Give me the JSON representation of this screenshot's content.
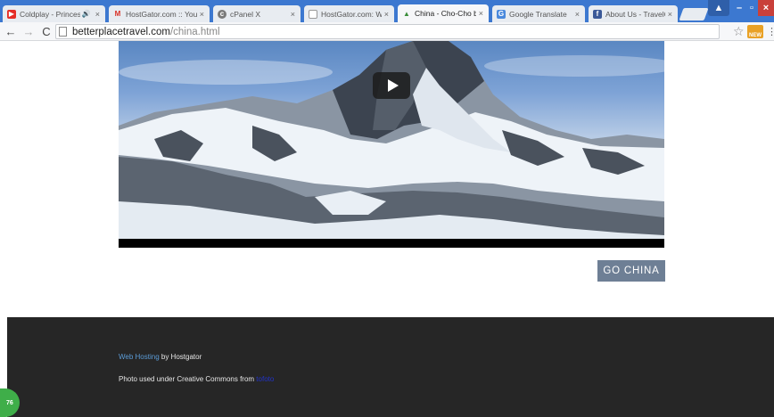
{
  "browser": {
    "tabs": [
      {
        "title": "Coldplay - Princes",
        "favicon": "youtube-icon",
        "audio": true,
        "active": false
      },
      {
        "title": "HostGator.com :: You",
        "favicon": "gmail-icon",
        "active": false
      },
      {
        "title": "cPanel X",
        "favicon": "cpanel-icon",
        "active": false
      },
      {
        "title": "HostGator.com: We",
        "favicon": "page-icon",
        "active": false
      },
      {
        "title": "China - Cho-Cho bet",
        "favicon": "travel-icon",
        "active": true
      },
      {
        "title": "Google Translate",
        "favicon": "translate-icon",
        "active": false
      },
      {
        "title": "About Us - TravelCho",
        "favicon": "facebook-icon",
        "active": false
      }
    ],
    "url_host": "betterplacetravel.com",
    "url_path": "/china.html",
    "extension_label": "NEW"
  },
  "main": {
    "cta_label": "GO CHINA"
  },
  "footer": {
    "hosting_link": "Web Hosting",
    "hosting_rest": " by Hostgator",
    "photo_text": "Photo used under Creative Commons from ",
    "photo_link": "tofoto"
  },
  "badge": {
    "count": "76"
  },
  "colors": {
    "tab_strip": "#3c78d0",
    "cta_bg": "#6e7f95",
    "footer_bg": "#262626",
    "link": "#5b9bd6"
  }
}
